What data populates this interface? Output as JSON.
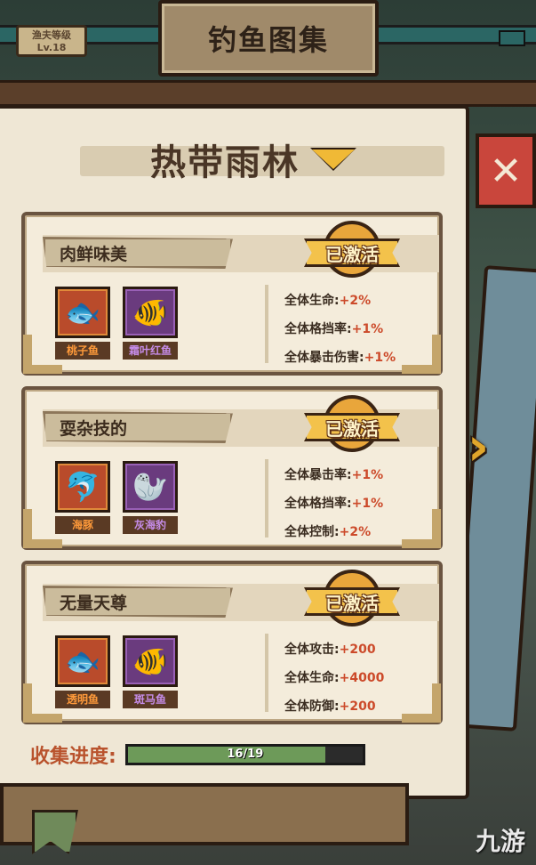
{
  "header": {
    "title": "钓鱼图集",
    "level_label": "渔夫等级",
    "level_value": "Lv.18"
  },
  "region": {
    "name": "热带雨林"
  },
  "sets": [
    {
      "name": "肉鲜味美",
      "status": "已激活",
      "fish": [
        {
          "name": "桃子鱼",
          "rarity": "orange",
          "icon": "peach-fish-icon"
        },
        {
          "name": "霜叶红鱼",
          "rarity": "purple",
          "icon": "frost-leaf-fish-icon"
        }
      ],
      "stats": [
        {
          "label": "全体生命:",
          "value": "+2%"
        },
        {
          "label": "全体格挡率:",
          "value": "+1%"
        },
        {
          "label": "全体暴击伤害:",
          "value": "+1%"
        }
      ]
    },
    {
      "name": "耍杂技的",
      "status": "已激活",
      "fish": [
        {
          "name": "海豚",
          "rarity": "orange",
          "icon": "dolphin-icon"
        },
        {
          "name": "灰海豹",
          "rarity": "purple",
          "icon": "grey-seal-icon"
        }
      ],
      "stats": [
        {
          "label": "全体暴击率:",
          "value": "+1%"
        },
        {
          "label": "全体格挡率:",
          "value": "+1%"
        },
        {
          "label": "全体控制:",
          "value": "+2%"
        }
      ]
    },
    {
      "name": "无量天尊",
      "status": "已激活",
      "fish": [
        {
          "name": "透明鱼",
          "rarity": "orange",
          "icon": "transparent-fish-icon"
        },
        {
          "name": "斑马鱼",
          "rarity": "purple",
          "icon": "zebra-fish-icon"
        }
      ],
      "stats": [
        {
          "label": "全体攻击:",
          "value": "+200"
        },
        {
          "label": "全体生命:",
          "value": "+4000"
        },
        {
          "label": "全体防御:",
          "value": "+200"
        }
      ]
    }
  ],
  "progress": {
    "label": "收集进度:",
    "text": "16/19",
    "fraction": 0.842
  },
  "watermark": "九游",
  "colors": {
    "stat_value": "#cc4a2a",
    "orange_rarity": "#ff9a3a",
    "purple_rarity": "#c58ce8",
    "progress_fill": "#6d9a59"
  }
}
